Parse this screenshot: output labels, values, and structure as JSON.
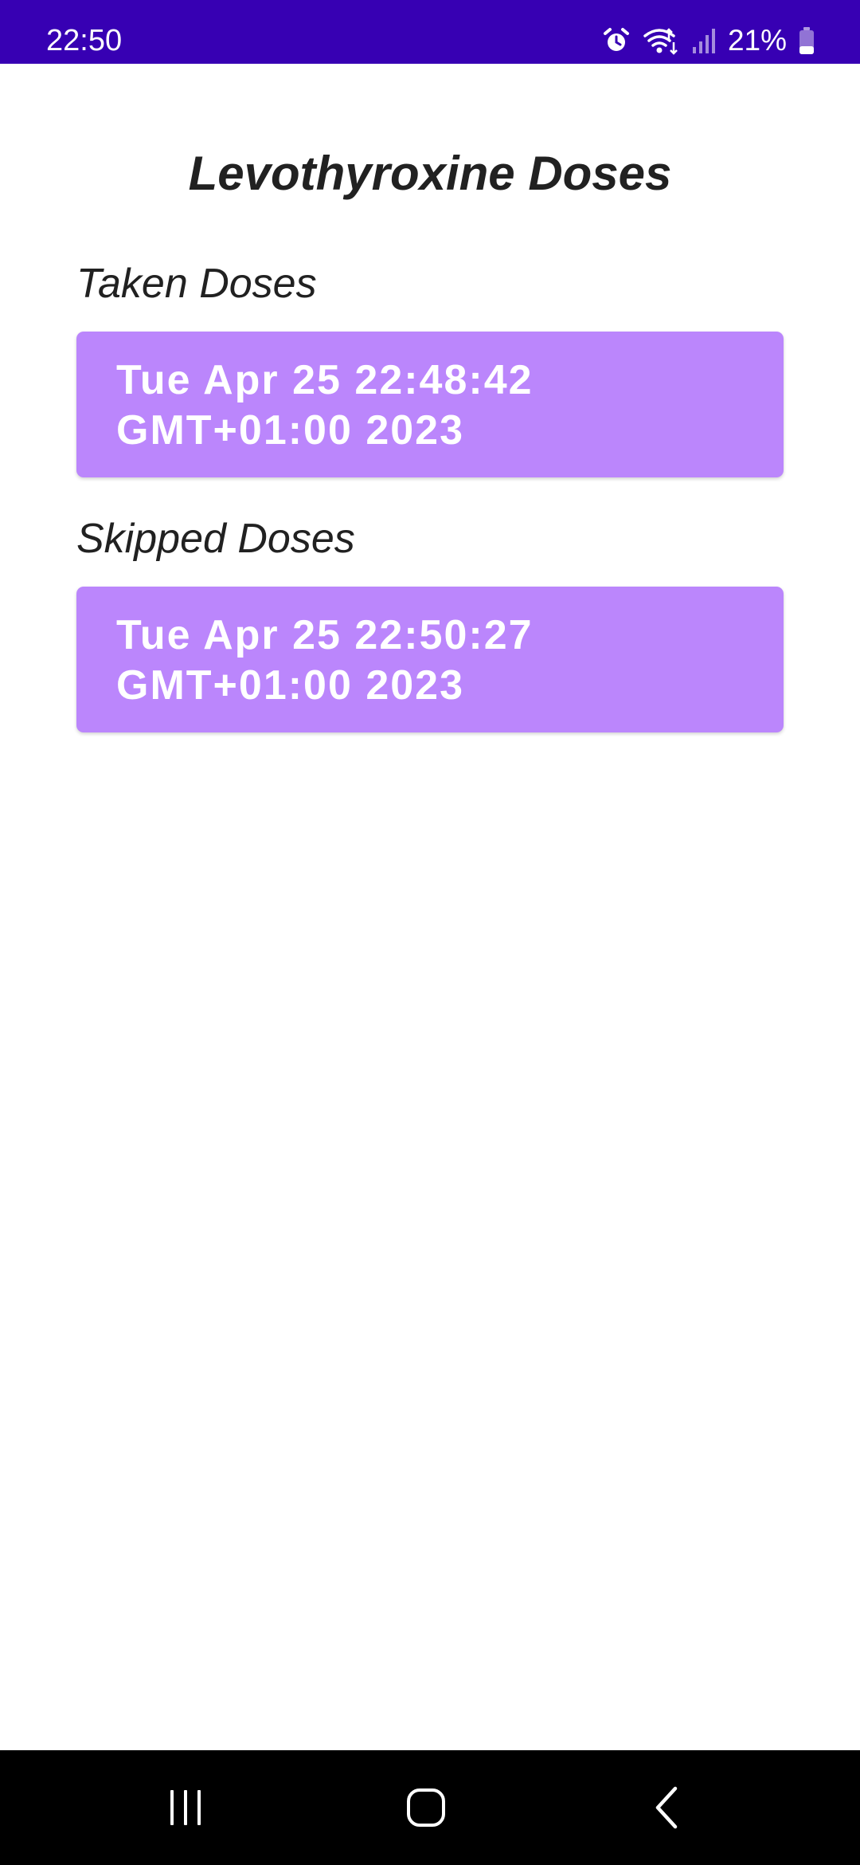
{
  "status_bar": {
    "time": "22:50",
    "battery_percent": "21%",
    "background_color": "#3700B3",
    "icons": [
      "alarm-icon",
      "wifi-icon",
      "signal-icon",
      "battery-icon"
    ]
  },
  "page": {
    "title": "Levothyroxine Doses"
  },
  "sections": {
    "taken": {
      "heading": "Taken Doses",
      "items": [
        {
          "line1": "Tue Apr 25 22:48:42",
          "line2": "GMT+01:00 2023"
        }
      ]
    },
    "skipped": {
      "heading": "Skipped Doses",
      "items": [
        {
          "line1": "Tue Apr 25 22:50:27",
          "line2": "GMT+01:00 2023"
        }
      ]
    }
  },
  "colors": {
    "card_background": "#BB86FC",
    "card_text": "#FFFFFF",
    "heading_text": "#212121"
  },
  "nav_bar": {
    "buttons": [
      "recents-icon",
      "home-icon",
      "back-icon"
    ]
  }
}
